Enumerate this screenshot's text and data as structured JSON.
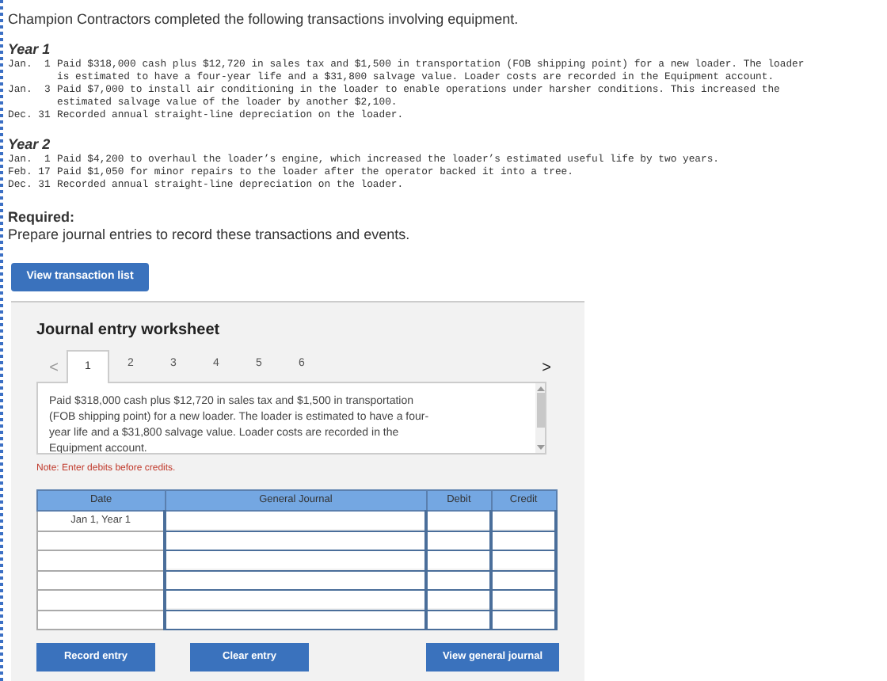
{
  "intro": "Champion Contractors completed the following transactions involving equipment.",
  "years": [
    {
      "heading": "Year 1",
      "entries": [
        {
          "date": "Jan.  1",
          "text": "Paid $318,000 cash plus $12,720 in sales tax and $1,500 in transportation (FOB shipping point) for a new loader. The loader\nis estimated to have a four-year life and a $31,800 salvage value. Loader costs are recorded in the Equipment account."
        },
        {
          "date": "Jan.  3",
          "text": "Paid $7,000 to install air conditioning in the loader to enable operations under harsher conditions. This increased the\nestimated salvage value of the loader by another $2,100."
        },
        {
          "date": "Dec. 31",
          "text": "Recorded annual straight-line depreciation on the loader."
        }
      ]
    },
    {
      "heading": "Year 2",
      "entries": [
        {
          "date": "Jan.  1",
          "text": "Paid $4,200 to overhaul the loader’s engine, which increased the loader’s estimated useful life by two years."
        },
        {
          "date": "Feb. 17",
          "text": "Paid $1,050 for minor repairs to the loader after the operator backed it into a tree."
        },
        {
          "date": "Dec. 31",
          "text": "Recorded annual straight-line depreciation on the loader."
        }
      ]
    }
  ],
  "required": {
    "heading": "Required:",
    "text": "Prepare journal entries to record these transactions and events."
  },
  "view_transactions_button": "View transaction list",
  "worksheet": {
    "title": "Journal entry worksheet",
    "prev": "<",
    "next": ">",
    "tabs": [
      {
        "label": "1",
        "selected": true
      },
      {
        "label": "2",
        "selected": false
      },
      {
        "label": "3",
        "selected": false
      },
      {
        "label": "4",
        "selected": false
      },
      {
        "label": "5",
        "selected": false
      },
      {
        "label": "6",
        "selected": false
      }
    ],
    "description": "Paid $318,000 cash plus $12,720 in sales tax and $1,500 in transportation\n(FOB shipping point) for a new loader. The loader is estimated to have a four-\nyear life and a $31,800 salvage value. Loader costs are recorded in the\nEquipment account.",
    "note": "Note: Enter debits before credits.",
    "table": {
      "columns": [
        "Date",
        "General Journal",
        "Debit",
        "Credit"
      ],
      "rows": [
        {
          "date": "Jan 1, Year 1"
        },
        {},
        {},
        {},
        {},
        {}
      ]
    },
    "buttons": [
      "Record entry",
      "Clear entry",
      "View general journal"
    ]
  }
}
